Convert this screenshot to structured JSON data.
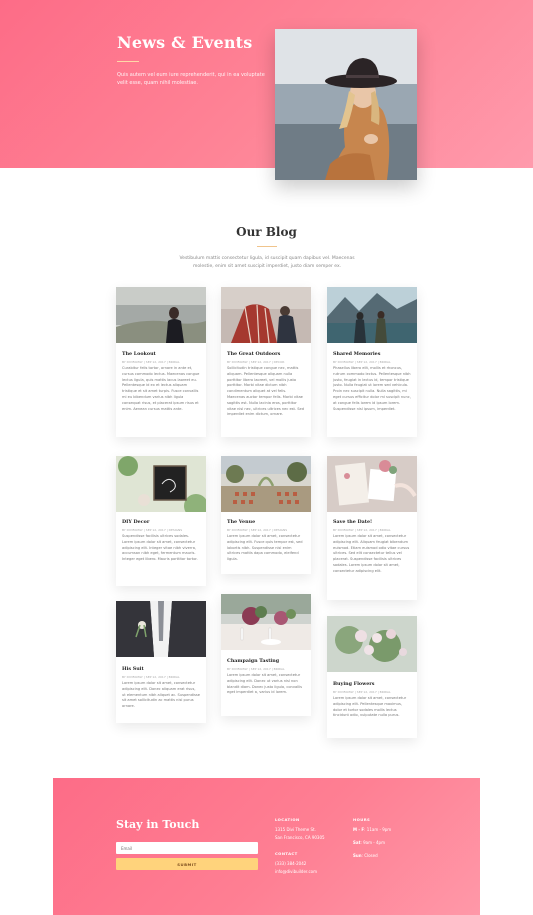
{
  "hero": {
    "title": "News & Events",
    "text": "Quis autem vel eum iure reprehenderit, qui in ea voluptate velit esse, quam nihil molestiae."
  },
  "blog": {
    "title": "Our Blog",
    "description": "Vestibulum mattis consectetur ligula, id suscipit quam dapibus vel. Maecenas molestie, enim sit amet suscipit imperdiet, justo diam semper ex.",
    "posts": [
      {
        "title": "The Lookout",
        "meta": "BY DIVIFAMILY | SEP 12, 2017 | BRIDAL",
        "excerpt": "Curabitur felis tortor, ornare in ante et, cursus commodo lectus. Maecenas congue lectus ligula, quis mattis lacus laoreet eu. Pellentesque id ex et lectus aliquam tristique et sit amet turpis. Fusce convallis mi eu bibendum varius nibh ligula consequat risus, et placerat ipsum risus et enim. Aenean cursus mattis ante."
      },
      {
        "title": "The Great Outdoors",
        "meta": "BY DIVIFAMILY | SEP 12, 2017 | DECOR",
        "excerpt": "Sollicitudin tristique congue nec, mattis aliquam. Pellentesque aliquam nulla porttitor libero laoreet, vel mollis justo porttitor. Morbi vitae dictum nibh condimentum aliquet at vel felis. Maecenas auctor tempor felis. Morbi vitae sagittis est. Nulla lacinia eros, porttitor vitae nisl nec, ultrices ultrices nec est. Sed imperdiet enim dictum, ornare."
      },
      {
        "title": "Shared Memories",
        "meta": "BY DIVIFAMILY | SEP 12, 2017 | BRIDAL",
        "excerpt": "Phasellus libero elit, mollis et rhoncus, rutrum commodo lectus. Pellentesque nibh justo, feugiat in lectus id, tempor tristique justo. Nulla feugiat ut lorem sed vehicula. Proin nec suscipit nulla. Nulla sagittis, mi eget cursus efficitur dolor mi suscipit nunc, at congue felis lorem id ipsum lorem. Suspendisse nisl ipsum, imperdiet."
      },
      {
        "title": "DIY Decor",
        "meta": "BY DIVIFAMILY | SEP 12, 2017 | DESIGNS",
        "excerpt": "Suspendisse facilisis ultrices sodales. Lorem ipsum dolor sit amet, consectetur adipiscing elit. Integer vitae nibh viverra, accumsan nibh eget, fermentum mauris. Integer eget libero. Mauris porttitor tortor."
      },
      {
        "title": "The Venue",
        "meta": "BY DIVIFAMILY | SEP 12, 2017 | DESIGNS",
        "excerpt": "Lorem ipsum dolor sit amet, consectetur adipiscing elit. Fusce quis tempor est, sed lobortis nibh. Suspendisse nisl enim ultrices mattis dapa commodo, eleifend ligula."
      },
      {
        "title": "Save the Date!",
        "meta": "BY DIVIFAMILY | SEP 12, 2017 | BRIDAL",
        "excerpt": "Lorem ipsum dolor sit amet, consectetur adipiscing elit. Aliquam feugiat bibendum euismod. Etiam euismod odio vitae cursus ultrices. Sed elit consectetur tellus vel placerat. Suspendisse facilisis ultrices sodales. Lorem ipsum dolor sit amet, consectetur adipiscing elit."
      },
      {
        "title": "His Suit",
        "meta": "BY DIVIFAMILY | SEP 12, 2017 | BRIDAL",
        "excerpt": "Lorem ipsum dolor sit amet, consectetur adipiscing elit. Donec aliquam erat risus, ut elementum nibh aliquet ac. Suspendisse sit amet sollicitudin ac mattis nisl purus ornare."
      },
      {
        "title": "Champaign Tasting",
        "meta": "BY DIVIFAMILY | SEP 12, 2017 | BRIDAL",
        "excerpt": "Lorem ipsum dolor sit amet, consectetur adipiscing elit. Donec ut varius nisl non blandit diam. Donec justo ligula, convallis eget imperdiet a, varius id lorem."
      },
      {
        "title": "Buying Flowers",
        "meta": "BY DIVIFAMILY | SEP 12, 2017 | BRIDAL",
        "excerpt": "Lorem ipsum dolor sit amet, consectetur adipiscing elit. Pellentesque maximus, dolor et tortor sodales mollis lectus tincidunt odio, vulputate nulla purus."
      }
    ]
  },
  "footer": {
    "title": "Stay in Touch",
    "email_placeholder": "Email",
    "submit_label": "SUBMIT",
    "location_label": "LOCATION",
    "address_line1": "1315 Divi Theme St.",
    "address_line2": "San Francisco, CA 90305",
    "contact_label": "CONTACT",
    "phone": "(333) 384-2042",
    "email": "info@divibuilder.com",
    "hours_label": "HOURS",
    "hours_weekday_day": "M - F",
    "hours_weekday_time": ": 11am - 9pm",
    "hours_sat_day": "Sat",
    "hours_sat_time": ": 9am - 4pm",
    "hours_sun_day": "Sun",
    "hours_sun_time": ": Closed"
  }
}
